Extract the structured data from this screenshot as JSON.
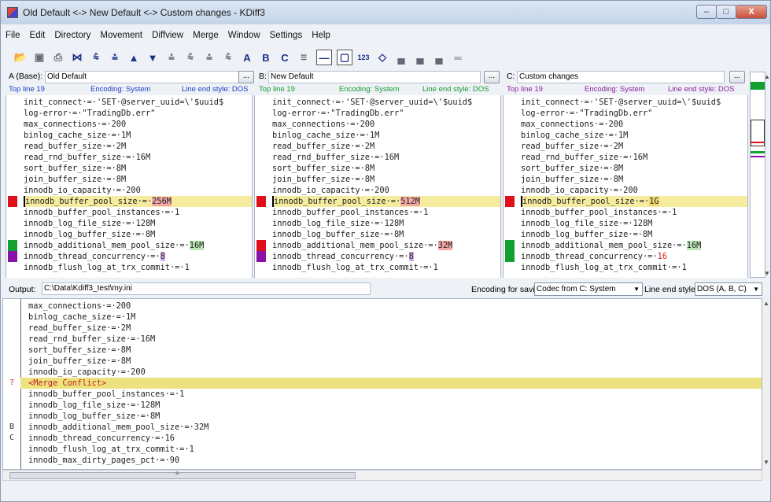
{
  "window": {
    "title": "Old Default <-> New Default <-> Custom changes - KDiff3",
    "controls": {
      "minimize": "‒",
      "maximize": "□",
      "close": "X"
    }
  },
  "menu": [
    {
      "label": "File"
    },
    {
      "label": "Edit"
    },
    {
      "label": "Directory"
    },
    {
      "label": "Movement"
    },
    {
      "label": "Diffview"
    },
    {
      "label": "Merge"
    },
    {
      "label": "Window"
    },
    {
      "label": "Settings"
    },
    {
      "label": "Help"
    }
  ],
  "toolbar": {
    "icons": [
      "open-icon",
      "save-icon",
      "print-icon",
      "go-top-icon",
      "go-bottom-icon",
      "prev-delta-icon",
      "prev-conflict-icon",
      "next-delta-icon",
      "next-conflict-icon",
      "prev-unsolved-icon",
      "next-unsolved-icon",
      "first-conflict-icon",
      "last-conflict-icon",
      "choose-a-icon",
      "choose-b-icon",
      "choose-c-icon",
      "auto-solve-icon",
      "show-whitespace-icon",
      "show-window-icon",
      "line-numbers-icon",
      "diamond-icon",
      "split-icon",
      "split-horizontal-icon",
      "dual-pane-icon",
      "sync-icon"
    ],
    "choose_a": "A",
    "choose_b": "B",
    "choose_c": "C",
    "line_numbers": "123"
  },
  "panes": {
    "a": {
      "header_label": "A (Base):",
      "name": "Old Default",
      "dots": "...",
      "top_line": "Top line 19",
      "encoding": "Encoding: System",
      "line_end": "Line end style: DOS",
      "lines": [
        "init_connect·=·'SET·@server_uuid=\\'$uuid$",
        "log-error·=·\"TradingDb.err\"",
        "max_connections·=·200",
        "binlog_cache_size·=·1M",
        "read_buffer_size·=·2M",
        "read_rnd_buffer_size·=·16M",
        "sort_buffer_size·=·8M",
        "join_buffer_size·=·8M",
        "innodb_io_capacity·=·200",
        "innodb_buffer_pool_size·=·",
        "innodb_buffer_pool_instances·=·1",
        "innodb_log_file_size·=·128M",
        "innodb_log_buffer_size·=·8M",
        "innodb_additional_mem_pool_size·=·",
        "innodb_thread_concurrency·=·",
        "innodb_flush_log_at_trx_commit·=·1"
      ],
      "v_buffer_pool": "256M",
      "v_mem_pool": "16M",
      "v_thread": "8"
    },
    "b": {
      "header_label": "B:",
      "name": "New Default",
      "dots": "...",
      "top_line": "Top line 19",
      "encoding": "Encoding: System",
      "line_end": "Line end style: DOS",
      "lines": [
        "init_connect·=·'SET·@server_uuid=\\'$uuid$",
        "log-error·=·\"TradingDb.err\"",
        "max_connections·=·200",
        "binlog_cache_size·=·1M",
        "read_buffer_size·=·2M",
        "read_rnd_buffer_size·=·16M",
        "sort_buffer_size·=·8M",
        "join_buffer_size·=·8M",
        "innodb_io_capacity·=·200",
        "innodb_buffer_pool_size·=·",
        "innodb_buffer_pool_instances·=·1",
        "innodb_log_file_size·=·128M",
        "innodb_log_buffer_size·=·8M",
        "innodb_additional_mem_pool_size·=·",
        "innodb_thread_concurrency·=·",
        "innodb_flush_log_at_trx_commit·=·1"
      ],
      "v_buffer_pool": "512M",
      "v_mem_pool": "32M",
      "v_thread": "8"
    },
    "c": {
      "header_label": "C:",
      "name": "Custom changes",
      "dots": "...",
      "top_line": "Top line 19",
      "encoding": "Encoding: System",
      "line_end": "Line end style: DOS",
      "lines": [
        "init_connect·=·'SET·@server_uuid=\\'$uuid$",
        "log-error·=·\"TradingDb.err\"",
        "max_connections·=·200",
        "binlog_cache_size·=·1M",
        "read_buffer_size·=·2M",
        "read_rnd_buffer_size·=·16M",
        "sort_buffer_size·=·8M",
        "join_buffer_size·=·8M",
        "innodb_io_capacity·=·200",
        "innodb_buffer_pool_size·=·",
        "innodb_buffer_pool_instances·=·1",
        "innodb_log_file_size·=·128M",
        "innodb_log_buffer_size·=·8M",
        "innodb_additional_mem_pool_size·=·",
        "innodb_thread_concurrency·=·",
        "innodb_flush_log_at_trx_commit·=·1"
      ],
      "v_buffer_pool": "1G",
      "v_mem_pool": "16M",
      "v_thread": "16"
    }
  },
  "output": {
    "label": "Output:",
    "path": "C:\\Data\\Kdiff3_test\\my.ini",
    "encoding_label": "Encoding for saving:",
    "encoding_value": "Codec from C: System",
    "line_end_label": "Line end style:",
    "line_end_value": "DOS (A, B, C)",
    "lines": [
      {
        "src": "",
        "text": "max_connections·=·200"
      },
      {
        "src": "",
        "text": "binlog_cache_size·=·1M"
      },
      {
        "src": "",
        "text": "read_buffer_size·=·2M"
      },
      {
        "src": "",
        "text": "read_rnd_buffer_size·=·16M"
      },
      {
        "src": "",
        "text": "sort_buffer_size·=·8M"
      },
      {
        "src": "",
        "text": "join_buffer_size·=·8M"
      },
      {
        "src": "",
        "text": "innodb_io_capacity·=·200"
      },
      {
        "src": "?",
        "text": "<Merge Conflict>"
      },
      {
        "src": "",
        "text": "innodb_buffer_pool_instances·=·1"
      },
      {
        "src": "",
        "text": "innodb_log_file_size·=·128M"
      },
      {
        "src": "",
        "text": "innodb_log_buffer_size·=·8M"
      },
      {
        "src": "B",
        "text": "innodb_additional_mem_pool_size·=·32M"
      },
      {
        "src": "C",
        "text": "innodb_thread_concurrency·=·16"
      },
      {
        "src": "",
        "text": "innodb_flush_log_at_trx_commit·=·1"
      },
      {
        "src": "",
        "text": "innodb_max_dirty_pages_pct·=·90"
      }
    ]
  },
  "colors": {
    "conflict_red": "#e0101a",
    "change_green": "#12a030",
    "change_purple": "#8a12a8",
    "highlight_yellow": "#f6eca0",
    "label_blue": "#2040c8",
    "label_green": "#1a9a30",
    "label_purple": "#8a1fa0"
  }
}
